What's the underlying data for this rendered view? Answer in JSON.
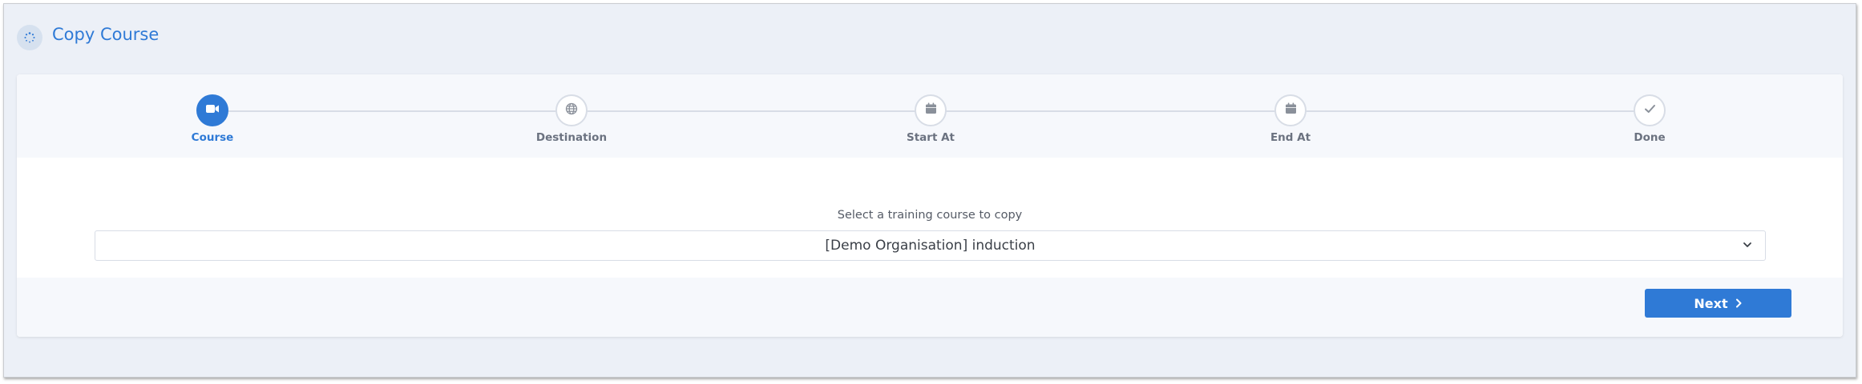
{
  "header": {
    "title": "Copy Course",
    "icon": "spinner-icon"
  },
  "stepper": {
    "steps": [
      {
        "label": "Course",
        "icon": "video-camera-icon",
        "active": true
      },
      {
        "label": "Destination",
        "icon": "globe-icon",
        "active": false
      },
      {
        "label": "Start At",
        "icon": "calendar-icon",
        "active": false
      },
      {
        "label": "End At",
        "icon": "calendar-icon",
        "active": false
      },
      {
        "label": "Done",
        "icon": "check-icon",
        "active": false
      }
    ]
  },
  "form": {
    "select_label": "Select a training course to copy",
    "selected_course": "[Demo Organisation] induction"
  },
  "footer": {
    "next_label": "Next"
  },
  "colors": {
    "accent": "#2f7ad6",
    "background": "#ecf0f7",
    "step_inactive": "#d8dde6"
  }
}
